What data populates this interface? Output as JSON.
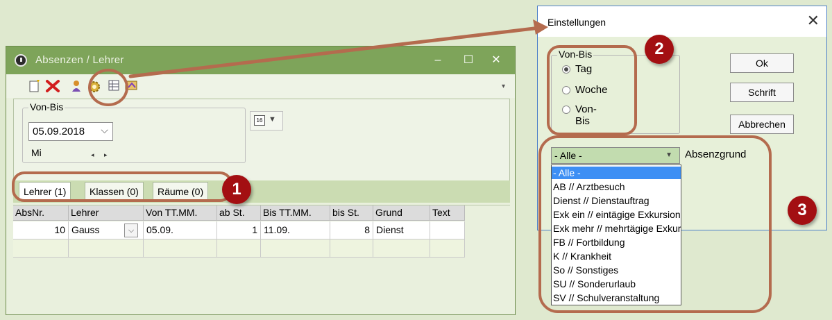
{
  "main_window": {
    "title": "Absenzen / Lehrer",
    "controls": {
      "minimize": "–",
      "maximize": "☐",
      "close": "✕"
    }
  },
  "toolbar": {
    "icons": [
      "new-document-icon",
      "delete-icon",
      "person-icon",
      "settings-gear-icon",
      "grid-icon",
      "export-icon"
    ],
    "more": "▾"
  },
  "von_bis": {
    "label": "Von-Bis",
    "date": "05.09.2018",
    "weekday": "Mi",
    "arrows": "◂ ▸"
  },
  "tabs": [
    {
      "label": "Lehrer (1)"
    },
    {
      "label": "Klassen (0)"
    },
    {
      "label": "Räume (0)"
    }
  ],
  "grid": {
    "columns": [
      "AbsNr.",
      "Lehrer",
      "Von TT.MM.",
      "ab St.",
      "Bis TT.MM.",
      "bis St.",
      "Grund",
      "Text"
    ],
    "rows": [
      {
        "absnr": "10",
        "lehrer": "Gauss",
        "von": "05.09.",
        "ab": "1",
        "bis": "11.09.",
        "bis_st": "8",
        "grund": "Dienst",
        "text": ""
      }
    ]
  },
  "dialog": {
    "title": "Einstellungen",
    "close": "✕",
    "von_bis_label": "Von-Bis",
    "radios": [
      {
        "label": "Tag",
        "checked": true
      },
      {
        "label": "Woche",
        "checked": false
      },
      {
        "label": "Von-Bis",
        "checked": false
      }
    ],
    "buttons": {
      "ok": "Ok",
      "font": "Schrift",
      "cancel": "Abbrechen"
    },
    "reason_combo": {
      "value": "- Alle -",
      "label": "Absenzgrund"
    },
    "reason_options": [
      "- Alle -",
      "AB // Arztbesuch",
      "Dienst // Dienstauftrag",
      "Exk ein // eintägige Exkursion",
      "Exk mehr // mehrtägige Exkursion",
      "FB // Fortbildung",
      "K // Krankheit",
      "So // Sonstiges",
      "SU // Sonderurlaub",
      "SV // Schulveranstaltung"
    ],
    "selected_index": 0
  },
  "annotations": {
    "n1": "1",
    "n2": "2",
    "n3": "3"
  },
  "colors": {
    "titlebar": "#7ea45a",
    "callout": "#b46b4e",
    "badge": "#a30f12",
    "selection": "#3d8ff4"
  }
}
